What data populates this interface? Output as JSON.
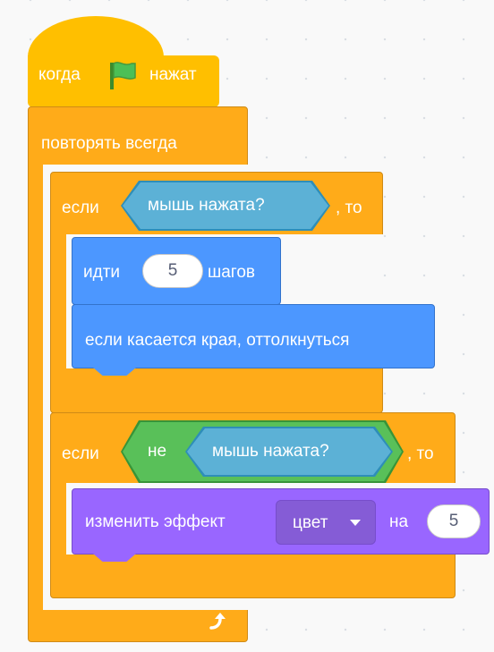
{
  "script": {
    "hat": {
      "prefix": "когда",
      "suffix": "нажат",
      "flag_icon": "green-flag-icon"
    },
    "forever_label": "повторять всегда",
    "if1": {
      "if_label": "если",
      "condition": "мышь нажата?",
      "then_label": ", то",
      "move": {
        "prefix": "идти",
        "value": "5",
        "suffix": "шагов"
      },
      "bounce": "если касается края, оттолкнуться"
    },
    "if2": {
      "if_label": "если",
      "not_label": "не",
      "condition": "мышь нажата?",
      "then_label": ", то",
      "effect": {
        "prefix": "изменить эффект",
        "dropdown": "цвет",
        "by_label": "на",
        "value": "5"
      }
    },
    "loop_icon": "loop-arrow-icon"
  },
  "colors": {
    "events": "#ffab19",
    "control": "#ffab19",
    "motion": "#4c97ff",
    "looks": "#9966ff",
    "sensing": "#5cb1d6",
    "operators": "#59c059"
  }
}
